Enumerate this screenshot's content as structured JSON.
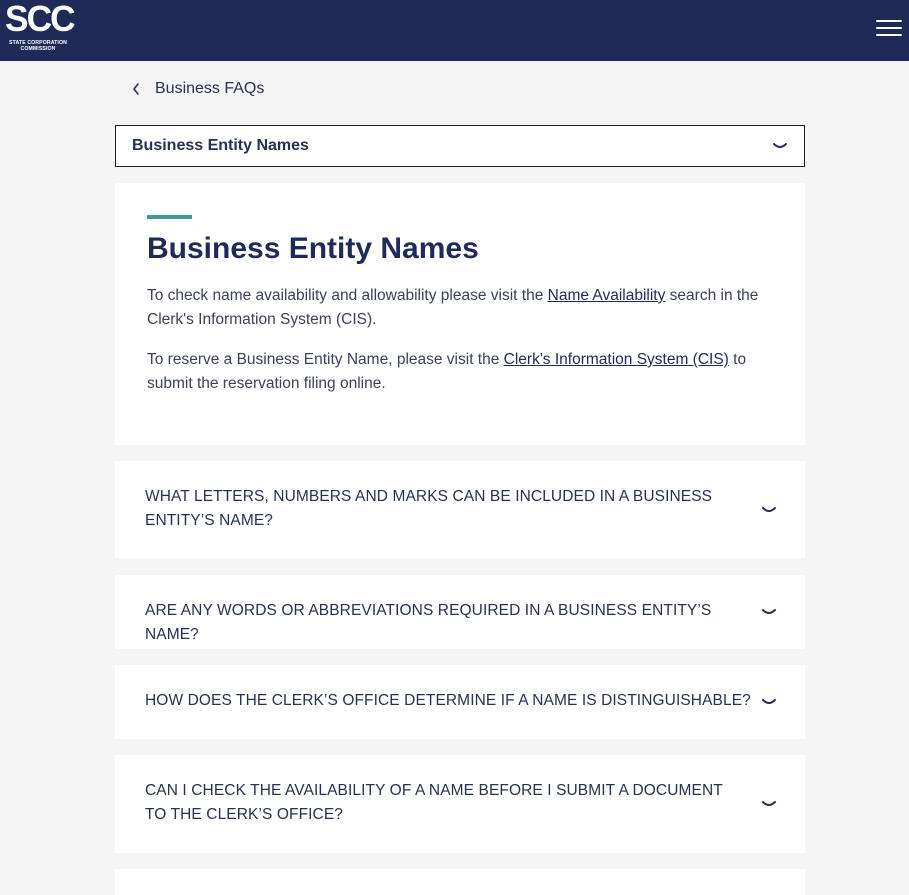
{
  "header": {
    "logo_text": "SCC",
    "logo_subtitle": "STATE CORPORATION COMMISSION",
    "colors": {
      "header_bg": "#1f2a58",
      "accent": "#3e9a9a"
    }
  },
  "breadcrumb": {
    "label": "Business FAQs"
  },
  "category_select": {
    "value": "Business Entity Names"
  },
  "intro": {
    "title": "Business Entity Names",
    "p1_before": "To check name availability and allowability please visit the ",
    "p1_link": "Name Availability",
    "p1_after": " search in the Clerk's Information System (CIS).",
    "p2_before": "To reserve a Business Entity Name, please visit the ",
    "p2_link": "Clerk's Information System (CIS)",
    "p2_after": " to submit the reservation filing online."
  },
  "faqs": [
    {
      "question": "WHAT LETTERS, NUMBERS AND MARKS CAN BE INCLUDED IN A BUSINESS ENTITY’S NAME?"
    },
    {
      "question": "ARE ANY WORDS OR ABBREVIATIONS REQUIRED IN A BUSINESS ENTITY’S NAME?"
    },
    {
      "question": "HOW DOES THE CLERK’S OFFICE DETERMINE IF A NAME IS DISTINGUISHABLE?"
    },
    {
      "question": "CAN I CHECK THE AVAILABILITY OF A NAME BEFORE I SUBMIT A DOCUMENT TO THE CLERK’S OFFICE?"
    }
  ]
}
